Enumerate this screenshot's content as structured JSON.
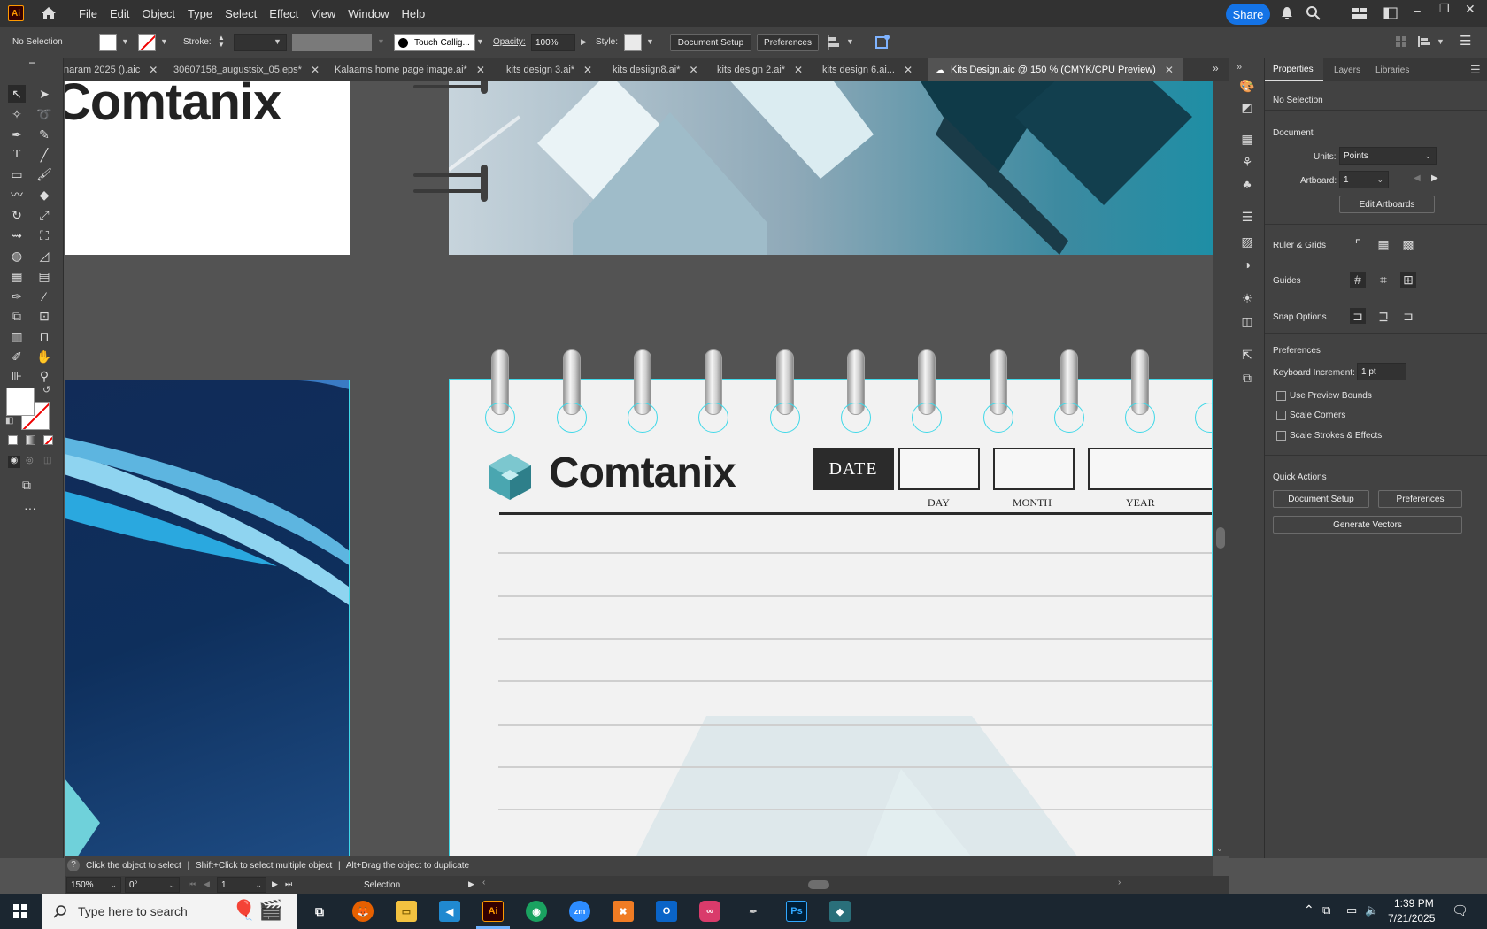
{
  "menubar": {
    "app_logo": "Ai",
    "items": [
      "File",
      "Edit",
      "Object",
      "Type",
      "Select",
      "Effect",
      "View",
      "Window",
      "Help"
    ],
    "share_label": "Share"
  },
  "control": {
    "selection": "No Selection",
    "stroke_label": "Stroke:",
    "brush": "Touch Callig...",
    "opacity_label": "Opacity:",
    "opacity_value": "100%",
    "style_label": "Style:",
    "document_setup": "Document Setup",
    "preferences": "Preferences"
  },
  "tabs": [
    {
      "label": "naram 2025 ().aic"
    },
    {
      "label": "30607158_augustsix_05.eps*"
    },
    {
      "label": "Kalaams home page image.ai*"
    },
    {
      "label": "kits design 3.ai*"
    },
    {
      "label": "kits desiign8.ai*"
    },
    {
      "label": "kits design 2.ai*"
    },
    {
      "label": "kits design 6.ai..."
    },
    {
      "label": "Kits Design.aic @ 150 % (CMYK/CPU Preview)"
    }
  ],
  "artboard": {
    "brand": "Comtanix",
    "date_label": "DATE",
    "day": "DAY",
    "month": "MONTH",
    "year": "YEAR"
  },
  "properties": {
    "tabs": [
      "Properties",
      "Layers",
      "Libraries"
    ],
    "selection": "No Selection",
    "document_heading": "Document",
    "units_label": "Units:",
    "units_value": "Points",
    "artboard_label": "Artboard:",
    "artboard_value": "1",
    "edit_artboards": "Edit Artboards",
    "ruler_grids": "Ruler & Grids",
    "guides": "Guides",
    "snap_options": "Snap Options",
    "preferences_heading": "Preferences",
    "keyboard_increment_label": "Keyboard Increment:",
    "keyboard_increment_value": "1 pt",
    "use_preview_bounds": "Use Preview Bounds",
    "scale_corners": "Scale Corners",
    "scale_strokes": "Scale Strokes & Effects",
    "quick_actions": "Quick Actions",
    "document_setup": "Document Setup",
    "preferences_btn": "Preferences",
    "generate_vectors": "Generate Vectors"
  },
  "status": {
    "hint_1": "Click the object to select",
    "hint_2": "Shift+Click to select multiple object",
    "hint_3": "Alt+Drag the object to duplicate",
    "zoom": "150%",
    "rotation": "0°",
    "artboard_nav": "1",
    "tool": "Selection"
  },
  "taskbar": {
    "search_placeholder": "Type here to search",
    "time": "1:39 PM",
    "date": "7/21/2025"
  },
  "colors": {
    "accent": "#1473e6",
    "teal": "#3fd8e8",
    "navy": "#0e2f5c"
  }
}
